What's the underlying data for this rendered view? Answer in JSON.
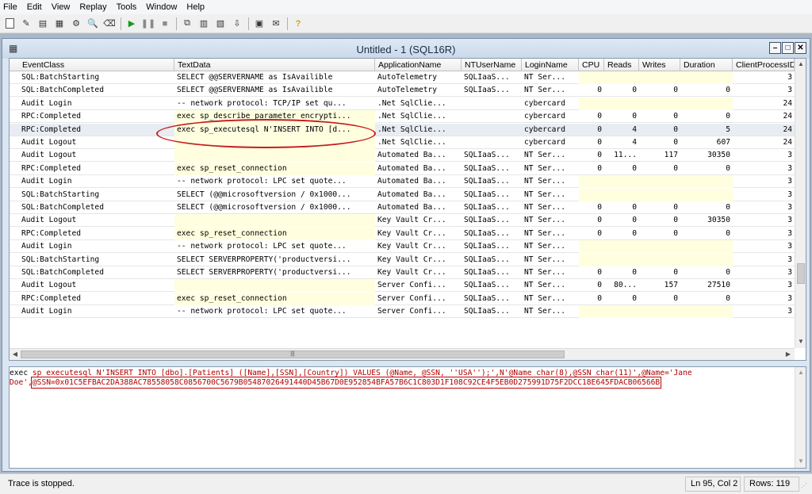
{
  "menu": [
    "File",
    "Edit",
    "View",
    "Replay",
    "Tools",
    "Window",
    "Help"
  ],
  "window": {
    "title": "Untitled - 1 (SQL16R)",
    "min": "–",
    "max": "□",
    "close": "✕"
  },
  "columns": [
    "EventClass",
    "TextData",
    "ApplicationName",
    "NTUserName",
    "LoginName",
    "CPU",
    "Reads",
    "Writes",
    "Duration",
    "ClientProcessID"
  ],
  "rows": [
    [
      "SQL:BatchStarting",
      "SELECT @@SERVERNAME as IsAvailible",
      "AutoTelemetry",
      "SQLIaaS...",
      "NT Ser...",
      "",
      "",
      "",
      "",
      "3"
    ],
    [
      "SQL:BatchCompleted",
      "SELECT @@SERVERNAME as IsAvailible",
      "AutoTelemetry",
      "SQLIaaS...",
      "NT Ser...",
      "0",
      "0",
      "0",
      "0",
      "3"
    ],
    [
      "Audit Login",
      "-- network protocol: TCP/IP  set qu...",
      ".Net SqlClie...",
      "",
      "cybercard",
      "",
      "",
      "",
      "",
      "24"
    ],
    [
      "RPC:Completed",
      "exec sp_describe_parameter_encrypti...",
      ".Net SqlClie...",
      "",
      "cybercard",
      "0",
      "0",
      "0",
      "0",
      "24"
    ],
    [
      "RPC:Completed",
      "exec sp_executesql N'INSERT INTO [d...",
      ".Net SqlClie...",
      "",
      "cybercard",
      "0",
      "4",
      "0",
      "5",
      "24"
    ],
    [
      "Audit Logout",
      "",
      ".Net SqlClie...",
      "",
      "cybercard",
      "0",
      "4",
      "0",
      "607",
      "24"
    ],
    [
      "Audit Logout",
      "",
      "Automated Ba...",
      "SQLIaaS...",
      "NT Ser...",
      "0",
      "11...",
      "117",
      "30350",
      "3"
    ],
    [
      "RPC:Completed",
      "exec sp_reset_connection",
      "Automated Ba...",
      "SQLIaaS...",
      "NT Ser...",
      "0",
      "0",
      "0",
      "0",
      "3"
    ],
    [
      "Audit Login",
      "-- network protocol: LPC  set quote...",
      "Automated Ba...",
      "SQLIaaS...",
      "NT Ser...",
      "",
      "",
      "",
      "",
      "3"
    ],
    [
      "SQL:BatchStarting",
      "SELECT (@@microsoftversion / 0x1000...",
      "Automated Ba...",
      "SQLIaaS...",
      "NT Ser...",
      "",
      "",
      "",
      "",
      "3"
    ],
    [
      "SQL:BatchCompleted",
      "SELECT (@@microsoftversion / 0x1000...",
      "Automated Ba...",
      "SQLIaaS...",
      "NT Ser...",
      "0",
      "0",
      "0",
      "0",
      "3"
    ],
    [
      "Audit Logout",
      "",
      "Key Vault Cr...",
      "SQLIaaS...",
      "NT Ser...",
      "0",
      "0",
      "0",
      "30350",
      "3"
    ],
    [
      "RPC:Completed",
      "exec sp_reset_connection",
      "Key Vault Cr...",
      "SQLIaaS...",
      "NT Ser...",
      "0",
      "0",
      "0",
      "0",
      "3"
    ],
    [
      "Audit Login",
      "-- network protocol: LPC  set quote...",
      "Key Vault Cr...",
      "SQLIaaS...",
      "NT Ser...",
      "",
      "",
      "",
      "",
      "3"
    ],
    [
      "SQL:BatchStarting",
      "SELECT SERVERPROPERTY('productversi...",
      "Key Vault Cr...",
      "SQLIaaS...",
      "NT Ser...",
      "",
      "",
      "",
      "",
      "3"
    ],
    [
      "SQL:BatchCompleted",
      "SELECT SERVERPROPERTY('productversi...",
      "Key Vault Cr...",
      "SQLIaaS...",
      "NT Ser...",
      "0",
      "0",
      "0",
      "0",
      "3"
    ],
    [
      "Audit Logout",
      "",
      "Server Confi...",
      "SQLIaaS...",
      "NT Ser...",
      "0",
      "80...",
      "157",
      "27510",
      "3"
    ],
    [
      "RPC:Completed",
      "exec sp_reset_connection",
      "Server Confi...",
      "SQLIaaS...",
      "NT Ser...",
      "0",
      "0",
      "0",
      "0",
      "3"
    ],
    [
      "Audit Login",
      "-- network protocol: LPC  set quote...",
      "Server Confi...",
      "SQLIaaS...",
      "NT Ser...",
      "",
      "",
      "",
      "",
      "3"
    ]
  ],
  "detail": {
    "prefix": "exec ",
    "line1": "sp_executesql N'INSERT INTO [dbo].[Patients] ([Name],[SSN],[Country]) VALUES (@Name, @SSN, ''USA'');',N'@Name char(8),@SSN char(11)',@Name='Jane Doe',",
    "line2": "@SSN=0x01C5EFBAC2DA388AC78558058C0856700C5679B05487026491440D45B67D0E952854BFA57B6C1C803D1F108C92CE4F5EB0D275991D75F2DCC18E645FDACB06566B"
  },
  "status": {
    "text": "Trace is stopped.",
    "position": "Ln 95, Col 2",
    "rows": "Rows: 119"
  }
}
